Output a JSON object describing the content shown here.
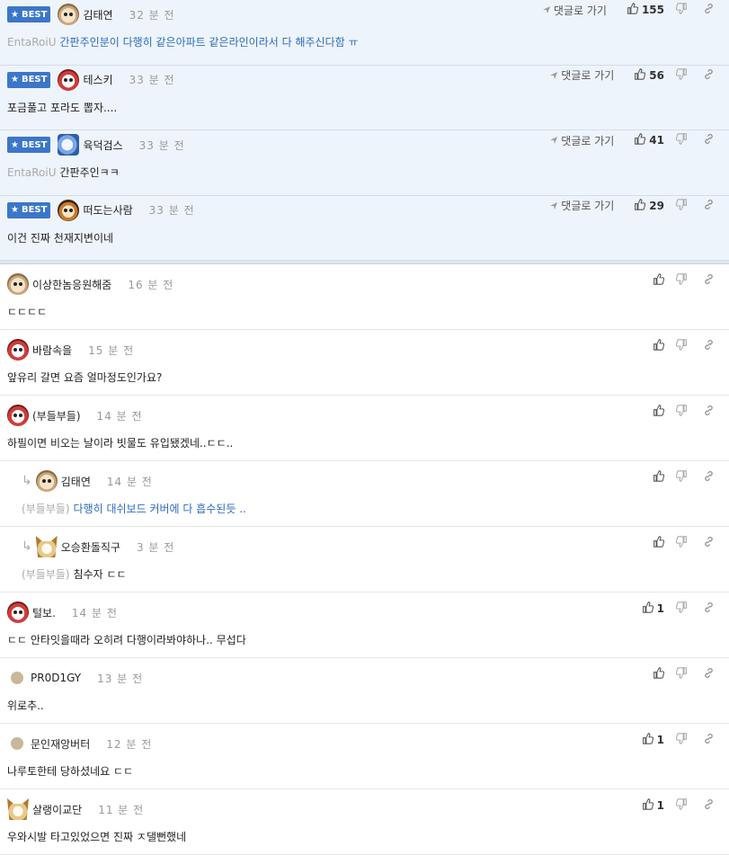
{
  "labels": {
    "best": "BEST",
    "goto_reply": "댓글로 가기"
  },
  "best_comments": [
    {
      "name": "김태연",
      "time": "32 분 전",
      "prefix": "EntaRoiU",
      "text": "간판주인분이 다행히 같은아파트 같은라인이라서 다 해주신다함 ㅠ",
      "text_blue": true,
      "likes": "155",
      "avatar": "dog"
    },
    {
      "name": "테스키",
      "time": "33 분 전",
      "prefix": "",
      "text": "포금풀고 포라도 뽑자....",
      "text_blue": false,
      "likes": "56",
      "avatar": "red"
    },
    {
      "name": "육덕검스",
      "time": "33 분 전",
      "prefix": "EntaRoiU",
      "text": "간판주인ㅋㅋ",
      "text_blue": false,
      "likes": "41",
      "avatar": "blue"
    },
    {
      "name": "떠도는사람",
      "time": "33 분 전",
      "prefix": "",
      "text": "이건 진짜 천재지변이네",
      "text_blue": false,
      "likes": "29",
      "avatar": "lion"
    }
  ],
  "comments": [
    {
      "name": "이상한놈응원해줌",
      "time": "16 분 전",
      "prefix": "",
      "text": "ㄷㄷㄷㄷ",
      "text_blue": false,
      "likes": "",
      "avatar": "dog",
      "reply": false
    },
    {
      "name": "바람속을",
      "time": "15 분 전",
      "prefix": "",
      "text": "앞유리 갈면 요즘 얼마정도인가요?",
      "text_blue": false,
      "likes": "",
      "avatar": "red",
      "reply": false
    },
    {
      "name": "(부들부들)",
      "time": "14 분 전",
      "prefix": "",
      "text": "하필이면 비오는 날이라 빗물도 유입됐겠네..ㄷㄷ..",
      "text_blue": false,
      "likes": "",
      "avatar": "red",
      "reply": false
    },
    {
      "name": "김태연",
      "time": "14 분 전",
      "prefix": "(부들부들)",
      "text": "다행히 대쉬보드 커버에 다 흡수된듯 ..",
      "text_blue": true,
      "likes": "",
      "avatar": "dog",
      "reply": true
    },
    {
      "name": "오승환돌직구",
      "time": "3 분 전",
      "prefix": "(부들부들)",
      "text": "침수자 ㄷㄷ",
      "text_blue": false,
      "likes": "",
      "avatar": "fox",
      "reply": true
    },
    {
      "name": "털보.",
      "time": "14 분 전",
      "prefix": "",
      "text": "ㄷㄷ 안타잇을때라 오히려 다행이라봐야하나.. 무섭다",
      "text_blue": false,
      "likes": "1",
      "avatar": "red",
      "reply": false
    },
    {
      "name": "PR0D1GY",
      "time": "13 분 전",
      "prefix": "",
      "text": "위로추..",
      "text_blue": false,
      "likes": "",
      "avatar": "dot",
      "reply": false
    },
    {
      "name": "문인재앙버터",
      "time": "12 분 전",
      "prefix": "",
      "text": "나루토한테 당하셨네요 ㄷㄷ",
      "text_blue": false,
      "likes": "1",
      "avatar": "dot",
      "reply": false
    },
    {
      "name": "살랭이교단",
      "time": "11 분 전",
      "prefix": "",
      "text": "우와시발 타고있었으면 진짜 ㅈ댈뻔했네",
      "text_blue": false,
      "likes": "1",
      "avatar": "fox",
      "reply": false
    }
  ]
}
